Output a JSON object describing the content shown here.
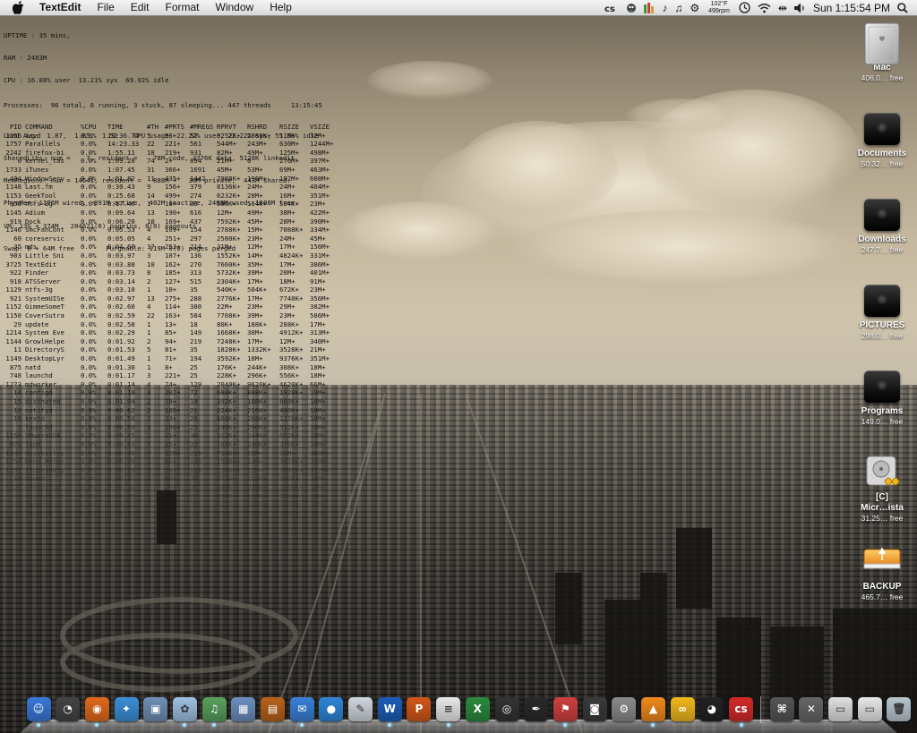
{
  "menubar": {
    "app_name": "TextEdit",
    "menus": [
      "File",
      "Edit",
      "Format",
      "Window",
      "Help"
    ],
    "temperature": "102°F",
    "fan_speed": "499rpm",
    "clock": "Sun 1:15:54 PM"
  },
  "geektool": {
    "uptime_lines": [
      "UPTIME : 35 mins,",
      "RAM : 2483M",
      "CPU : 16.88% user  13.21% sys  69.92% idle",
      "Processes:  96 total, 6 running, 3 stuck, 87 sleeping... 447 threads     13:15:45"
    ],
    "stats_lines": [
      "Load Avg:  1.87,  1.85,  1.52    CPU usage: 22.22% user, 22.22% sys, 55.56% idle",
      "SharedLibs: num =    7, resident =    78M code, 3776K data, 5128K linkedit.",
      "MemRegions: num = 14641, resident =   888M +   30M private,  443M shared.",
      "PhysMem: 1176M wired,  891M active,  402M inactive, 2488M used, 1608M free.",
      "VM: 13G + 374M   204621(0) pageins, 0(0) pageouts",
      "Swap: 0 + 64M free        Purgeable: 119M 0(0) pages purged"
    ],
    "columns": [
      "PID",
      "COMMAND",
      "%CPU",
      "TIME",
      "#TH",
      "#PRTS",
      "#MREGS",
      "RPRVT",
      "RSHRD",
      "RSIZE",
      "VSIZE"
    ],
    "rows": [
      [
        "1156",
        "iavd",
        "0.0%",
        "19:36.74",
        "5",
        "56+",
        "52",
        "9252K+",
        "2868K+",
        "11M+",
        "32M+"
      ],
      [
        "1757",
        "Parallels",
        "0.0%",
        "14:23.33",
        "22",
        "221+",
        "561",
        "544M+",
        "243M+",
        "630M+",
        "1244M+"
      ],
      [
        "2242",
        "firefox-bi",
        "0.0%",
        "1:55.11",
        "18",
        "219+",
        "931",
        "82M+",
        "49M+",
        "125M+",
        "498M+"
      ],
      [
        "0",
        "kernel_tas",
        "0.0%",
        "1:09.20",
        "74",
        "2+",
        "894",
        "21M+",
        "0",
        "270M+",
        "397M+"
      ],
      [
        "1733",
        "iTunes",
        "0.0%",
        "1:07.45",
        "31",
        "366+",
        "1691",
        "45M+",
        "53M+",
        "69M+",
        "463M+"
      ],
      [
        "404",
        "WindowServ",
        "0.0%",
        "1:01.82",
        "11",
        "435+",
        "1442",
        "7988K+",
        "196M+",
        "192M+",
        "608M+"
      ],
      [
        "1148",
        "Last.fm",
        "0.0%",
        "0:30.43",
        "9",
        "156+",
        "379",
        "8136K+",
        "24M+",
        "24M+",
        "404M+"
      ],
      [
        "1153",
        "GeekTool",
        "0.0%",
        "0:25.68",
        "14",
        "499+",
        "274",
        "6232K+",
        "28M+",
        "16M+",
        "351M+"
      ],
      [
        "850",
        "ntfs-3g",
        "0.0%",
        "0:17.46",
        "1",
        "10+",
        "35",
        "500K+",
        "504K+",
        "584K+",
        "23M+"
      ],
      [
        "1145",
        "Adium",
        "0.0%",
        "0:09.64",
        "13",
        "190+",
        "616",
        "12M+",
        "49M+",
        "38M+",
        "422M+"
      ],
      [
        "919",
        "Dock",
        "0.0%",
        "0:06.20",
        "10",
        "169+",
        "437",
        "7592K+",
        "45M+",
        "28M+",
        "390M+"
      ],
      [
        "1146",
        "smcFanCont",
        "0.0%",
        "0:05.53",
        "4",
        "109+",
        "154",
        "2788K+",
        "15M+",
        "7088K+",
        "334M+"
      ],
      [
        "60",
        "coreservic",
        "0.0%",
        "0:05.05",
        "4",
        "251+",
        "297",
        "2580K+",
        "23M+",
        "24M+",
        "45M+"
      ],
      [
        "35",
        "mds",
        "0.0%",
        "0:04.60",
        "17",
        "253+",
        "214",
        "31M+",
        "12M+",
        "17M+",
        "156M+"
      ],
      [
        "903",
        "Little Sni",
        "0.0%",
        "0:03.97",
        "3",
        "107+",
        "136",
        "1552K+",
        "14M+",
        "4824K+",
        "331M+"
      ],
      [
        "3725",
        "TextEdit",
        "0.0%",
        "0:03.88",
        "10",
        "162+",
        "270",
        "7660K+",
        "35M+",
        "17M+",
        "386M+"
      ],
      [
        "922",
        "Finder",
        "0.0%",
        "0:03.73",
        "8",
        "185+",
        "313",
        "5732K+",
        "39M+",
        "20M+",
        "401M+"
      ],
      [
        "918",
        "ATSServer",
        "0.0%",
        "0:03.14",
        "2",
        "127+",
        "515",
        "2304K+",
        "17M+",
        "18M+",
        "91M+"
      ],
      [
        "1129",
        "ntfs-3g",
        "0.0%",
        "0:03.10",
        "1",
        "10+",
        "35",
        "540K+",
        "504K+",
        "672K+",
        "23M+"
      ],
      [
        "921",
        "SystemUISe",
        "0.0%",
        "0:02.97",
        "13",
        "275+",
        "288",
        "2776K+",
        "17M+",
        "7740K+",
        "356M+"
      ],
      [
        "1152",
        "GimmeSomeT",
        "0.0%",
        "0:02.60",
        "4",
        "114+",
        "380",
        "22M+",
        "23M+",
        "29M+",
        "382M+"
      ],
      [
        "1150",
        "CoverSutra",
        "0.0%",
        "0:02.59",
        "22",
        "163+",
        "584",
        "7708K+",
        "39M+",
        "23M+",
        "586M+"
      ],
      [
        "29",
        "update",
        "0.0%",
        "0:02.58",
        "1",
        "13+",
        "18",
        "80K+",
        "188K+",
        "288K+",
        "17M+"
      ],
      [
        "1214",
        "System Eve",
        "0.0%",
        "0:02.29",
        "1",
        "85+",
        "149",
        "1668K+",
        "30M+",
        "4912K+",
        "313M+"
      ],
      [
        "1144",
        "GrowlHelpe",
        "0.0%",
        "0:01.92",
        "2",
        "94+",
        "219",
        "7248K+",
        "17M+",
        "12M+",
        "340M+"
      ],
      [
        "11",
        "DirectoryS",
        "0.0%",
        "0:01.53",
        "5",
        "81+",
        "35",
        "1828K+",
        "1332K+",
        "3528K+",
        "21M+"
      ],
      [
        "1149",
        "DesktopLyr",
        "0.0%",
        "0:01.49",
        "1",
        "71+",
        "194",
        "3592K+",
        "18M+",
        "9376K+",
        "351M+"
      ],
      [
        "875",
        "natd",
        "0.0%",
        "0:01.30",
        "1",
        "8+",
        "25",
        "176K+",
        "244K+",
        "308K+",
        "18M+"
      ],
      [
        "748",
        "launchd",
        "0.0%",
        "0:01.17",
        "3",
        "221+",
        "25",
        "228K+",
        "296K+",
        "556K+",
        "18M+"
      ],
      [
        "1273",
        "mdworker",
        "0.0%",
        "0:01.14",
        "4",
        "74+",
        "129",
        "2040K+",
        "9620K+",
        "4620K+",
        "66M+"
      ],
      [
        "14",
        "configd",
        "0.0%",
        "0:01.10",
        "3",
        "202+",
        "72",
        "680K+",
        "888K+",
        "1928K+",
        "19M+"
      ],
      [
        "15",
        "distnoted",
        "0.0%",
        "0:01.04",
        "2",
        "78+",
        "19",
        "392K+",
        "188K+",
        "868K+",
        "18M+"
      ],
      [
        "12",
        "notifyd",
        "0.0%",
        "0:00.62",
        "2",
        "185+",
        "21",
        "224K+",
        "216K+",
        "480K+",
        "18M+"
      ],
      [
        "16",
        "kextd",
        "0.0%",
        "0:00.58",
        "2",
        "33+",
        "20",
        "668K+",
        "268K+",
        "1276K+",
        "18M+"
      ],
      [
        "1",
        "launchd",
        "0.0%",
        "0:00.50",
        "3",
        "100+",
        "25",
        "240K+",
        "296K+",
        "512K+",
        "18M+"
      ],
      [
        "1158",
        "VMwareUSB",
        "0.0%",
        "0:00.45",
        "2",
        "21+",
        "30",
        "312K+",
        "244K+",
        "652K+",
        "18M+"
      ],
      [
        "872",
        "lipd",
        "0.0%",
        "0:00.41",
        "1",
        "15+",
        "22",
        "184K+",
        "240K+",
        "376K+",
        "18M+"
      ],
      [
        "1147",
        "Quicksilve",
        "0.0%",
        "0:00.40",
        "7",
        "120+",
        "210",
        "7180K+",
        "18M+",
        "16M+",
        "360M+"
      ],
      [
        "1154",
        "Menu Meter",
        "0.0%",
        "0:00.38",
        "3",
        "66+",
        "140",
        "1580K+",
        "14M+",
        "3820K+",
        "330M+"
      ],
      [
        "1151",
        "iTunesHelp",
        "0.0%",
        "0:00.35",
        "3",
        "58+",
        "118",
        "1200K+",
        "12M+",
        "3096K+",
        "312M+"
      ],
      [
        "18",
        "blued",
        "0.0%",
        "0:00.31",
        "2",
        "60+",
        "30",
        "372K+",
        "210K+",
        "980K+",
        "18M+"
      ],
      [
        "1128",
        "securityd",
        "0.0%",
        "0:00.28",
        "2",
        "29+",
        "35",
        "680K+",
        "230K+",
        "1050K+",
        "18M+"
      ],
      [
        "13",
        "diskarbitr",
        "0.0%",
        "0:00.25",
        "1",
        "30+",
        "17",
        "236K+",
        "190K+",
        "720K+",
        "18M+"
      ],
      [
        "15",
        "fseventsd",
        "0.0%",
        "0:00.21",
        "3",
        "25+",
        "18",
        "412K+",
        "188K+",
        "640K+",
        "18M+"
      ],
      [
        "17",
        "launchd",
        "0.0%",
        "0:00.19",
        "2",
        "42+",
        "19",
        "156K+",
        "190K+",
        "380K+",
        "18M+"
      ]
    ]
  },
  "desktop_icons": [
    {
      "label": "Mac",
      "sub": "406.0… free"
    },
    {
      "label": "Documents",
      "sub": "50.32… free"
    },
    {
      "label": "Downloads",
      "sub": "247.7… free"
    },
    {
      "label": "PICTURES",
      "sub": "298.0… free"
    },
    {
      "label": "Programs",
      "sub": "149.0… free"
    },
    {
      "label": "[C]",
      "label2": "Micr…ista",
      "sub": "31.25… free"
    },
    {
      "label": "BACKUP",
      "sub": "465.7… free"
    }
  ],
  "dock": {
    "items": [
      {
        "name": "Finder",
        "icon": "finder-icon",
        "color": "#3a78d8",
        "glyph": "☺"
      },
      {
        "name": "Dashboard",
        "icon": "dashboard-icon",
        "color": "#444444",
        "glyph": "◔"
      },
      {
        "name": "Firefox",
        "icon": "firefox-icon",
        "color": "#e06a1c",
        "glyph": "◉"
      },
      {
        "name": "Safari",
        "icon": "safari-icon",
        "color": "#3b8fd6",
        "glyph": "✦"
      },
      {
        "name": "Preview",
        "icon": "preview-icon",
        "color": "#6f8fb5",
        "glyph": "▣"
      },
      {
        "name": "Adium",
        "icon": "adium-icon",
        "color": "#9fc0e0",
        "glyph": "✿"
      },
      {
        "name": "iTunes",
        "icon": "itunes-icon",
        "color": "#58a05e",
        "glyph": "♫"
      },
      {
        "name": "iPhoto",
        "icon": "iphoto-icon",
        "color": "#6b8fbf",
        "glyph": "▦"
      },
      {
        "name": "Photo Booth",
        "icon": "photo-booth-icon",
        "color": "#b8621b",
        "glyph": "▤"
      },
      {
        "name": "Mail",
        "icon": "mail-icon",
        "color": "#3a80d8",
        "glyph": "✉"
      },
      {
        "name": "iChat",
        "icon": "ichat-icon",
        "color": "#2e86d6",
        "glyph": "●"
      },
      {
        "name": "Script Editor",
        "icon": "script-editor-icon",
        "color": "#cfd6dc",
        "glyph": "✎"
      },
      {
        "name": "Word",
        "icon": "word-icon",
        "color": "#1c5db8",
        "glyph": "W"
      },
      {
        "name": "PowerPoint",
        "icon": "powerpoint-icon",
        "color": "#d2571a",
        "glyph": "P"
      },
      {
        "name": "TextEdit",
        "icon": "textedit-icon",
        "color": "#e8e8e8",
        "glyph": "≡"
      },
      {
        "name": "Excel",
        "icon": "excel-icon",
        "color": "#2b8a3e",
        "glyph": "X"
      },
      {
        "name": "Aperture",
        "icon": "aperture-icon",
        "color": "#333333",
        "glyph": "◎"
      },
      {
        "name": "Pen Tool",
        "icon": "pen-icon",
        "color": "#2a2a2a",
        "glyph": "✒"
      },
      {
        "name": "Flagged",
        "icon": "flag-icon",
        "color": "#d04040",
        "glyph": "⚑"
      },
      {
        "name": "Camera",
        "icon": "camera-icon",
        "color": "#3a3a3a",
        "glyph": "◙"
      },
      {
        "name": "Network Tool",
        "icon": "network-tool-icon",
        "color": "#8a8a8a",
        "glyph": "⚙"
      },
      {
        "name": "VLC",
        "icon": "vlc-icon",
        "color": "#f08a1c",
        "glyph": "▲"
      },
      {
        "name": "Parallels",
        "icon": "parallels-icon",
        "color": "#f0b81c",
        "glyph": "∞"
      },
      {
        "name": "Adium Duck",
        "icon": "duck-icon",
        "color": "#222222",
        "glyph": "◕"
      },
      {
        "name": "Last.fm",
        "icon": "lastfm-icon",
        "color": "#d42a2a",
        "glyph": "cs"
      },
      {
        "name": "Terminal Stack",
        "icon": "stack-icon",
        "color": "#555555",
        "glyph": "⌘"
      },
      {
        "name": "Applications",
        "icon": "applications-icon",
        "color": "#666666",
        "glyph": "✕"
      },
      {
        "name": "Documents Stack",
        "icon": "documents-stack-icon",
        "color": "#e0e0e0",
        "glyph": "▭"
      },
      {
        "name": "Downloads Stack",
        "icon": "downloads-stack-icon",
        "color": "#e8e8e8",
        "glyph": "▭"
      },
      {
        "name": "Trash",
        "icon": "trash-icon",
        "color": "#b8c6d0",
        "glyph": "🗑"
      }
    ]
  }
}
